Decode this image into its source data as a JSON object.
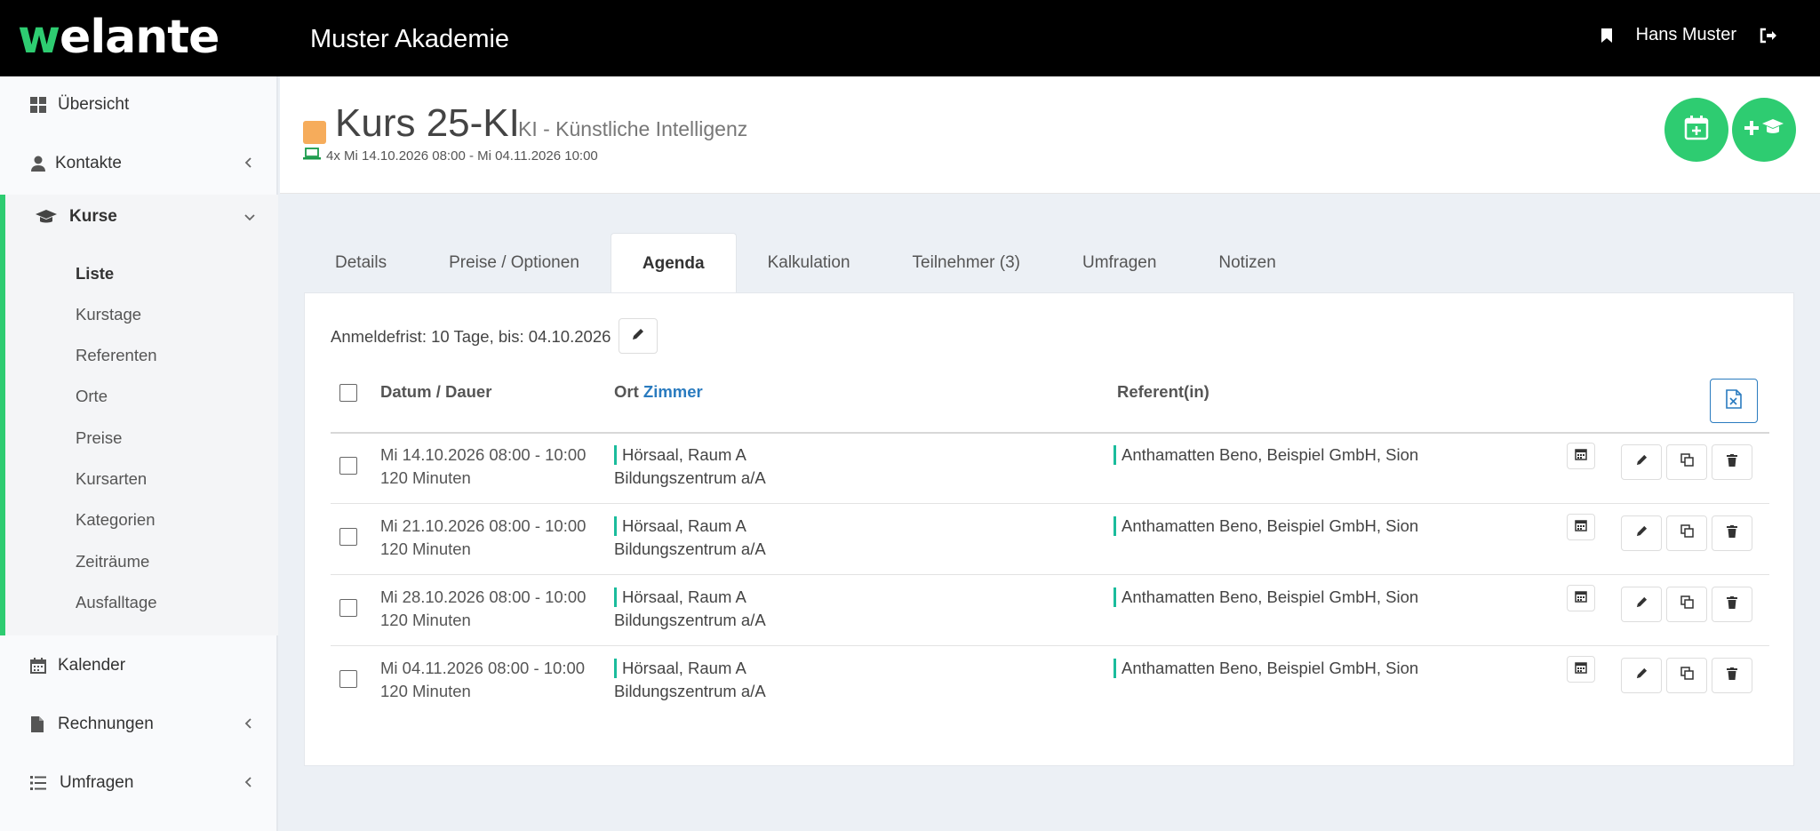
{
  "header": {
    "logo_text": "welante",
    "org_title": "Muster Akademie",
    "user_name": "Hans Muster"
  },
  "sidebar": {
    "items": [
      {
        "label": "Übersicht",
        "icon": "dashboard-icon"
      },
      {
        "label": "Kontakte",
        "icon": "user-icon"
      },
      {
        "label": "Kurse",
        "icon": "graduation-cap-icon"
      },
      {
        "label": "Kalender",
        "icon": "calendar-icon"
      },
      {
        "label": "Rechnungen",
        "icon": "file-icon"
      },
      {
        "label": "Umfragen",
        "icon": "list-icon"
      }
    ],
    "kurse_sub": [
      "Liste",
      "Kurstage",
      "Referenten",
      "Orte",
      "Preise",
      "Kursarten",
      "Kategorien",
      "Zeiträume",
      "Ausfalltage"
    ]
  },
  "course": {
    "code": "Kurs 25-KI",
    "name": "KI - Künstliche Intelligenz",
    "meta": "4x Mi 14.10.2026 08:00 - Mi 04.11.2026 10:00",
    "color": "#f6ac5b"
  },
  "tabs": [
    "Details",
    "Preise / Optionen",
    "Agenda",
    "Kalkulation",
    "Teilnehmer (3)",
    "Umfragen",
    "Notizen"
  ],
  "active_tab": "Agenda",
  "agenda": {
    "deadline": "Anmeldefrist: 10 Tage, bis: 04.10.2026",
    "columns": {
      "date": "Datum / Dauer",
      "location": "Ort",
      "room_link": "Zimmer",
      "speaker": "Referent(in)"
    },
    "rows": [
      {
        "date": "Mi 14.10.2026 08:00 - 10:00",
        "duration": "120 Minuten",
        "room": "Hörsaal, Raum A",
        "place": "Bildungszentrum a/A",
        "speaker": "Anthamatten Beno, Beispiel GmbH, Sion"
      },
      {
        "date": "Mi 21.10.2026 08:00 - 10:00",
        "duration": "120 Minuten",
        "room": "Hörsaal, Raum A",
        "place": "Bildungszentrum a/A",
        "speaker": "Anthamatten Beno, Beispiel GmbH, Sion"
      },
      {
        "date": "Mi 28.10.2026 08:00 - 10:00",
        "duration": "120 Minuten",
        "room": "Hörsaal, Raum A",
        "place": "Bildungszentrum a/A",
        "speaker": "Anthamatten Beno, Beispiel GmbH, Sion"
      },
      {
        "date": "Mi 04.11.2026 08:00 - 10:00",
        "duration": "120 Minuten",
        "room": "Hörsaal, Raum A",
        "place": "Bildungszentrum a/A",
        "speaker": "Anthamatten Beno, Beispiel GmbH, Sion"
      }
    ]
  },
  "colors": {
    "brand_green": "#2ecc71",
    "accent_teal": "#1abc9c",
    "link_blue": "#2a7bbf"
  }
}
